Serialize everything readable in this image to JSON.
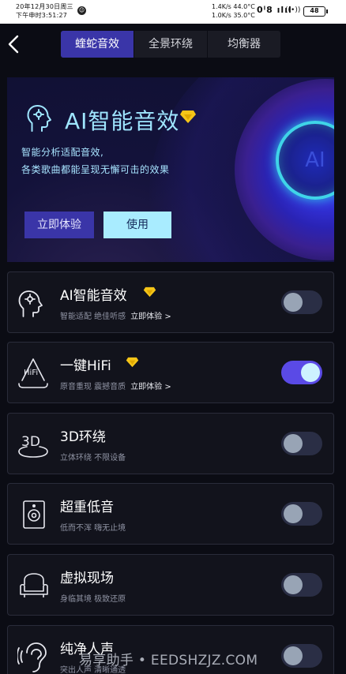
{
  "status_bar": {
    "date": "20年12月30日周三",
    "time": "下午申时3:51:27",
    "speed_up": "1.4K/s 44.0°C",
    "speed_down": "1.0K/s 35.0°C",
    "signal_icons": "0ᑊ8 ılıl",
    "wifi": "((•))",
    "battery": "48"
  },
  "tabs": [
    {
      "label": "蝰蛇音效",
      "active": true
    },
    {
      "label": "全景环绕",
      "active": false
    },
    {
      "label": "均衡器",
      "active": false
    }
  ],
  "banner": {
    "title": "AI智能音效",
    "desc_line1": "智能分析适配音效,",
    "desc_line2": "各类歌曲都能呈现无懈可击的效果",
    "try_button": "立即体验",
    "use_button": "使用",
    "ring_text": "AI"
  },
  "cards": [
    {
      "title": "AI智能音效",
      "subtitle": "智能适配 绝佳听感",
      "link": "立即体验 >",
      "vip": true,
      "enabled": false,
      "icon": "ai-head-icon"
    },
    {
      "title": "一键HiFi",
      "subtitle": "原音重现 震撼音质",
      "link": "立即体验 >",
      "vip": true,
      "enabled": true,
      "icon": "hifi-icon"
    },
    {
      "title": "3D环绕",
      "subtitle": "立体环绕 不限设备",
      "vip": false,
      "enabled": false,
      "icon": "3d-icon",
      "icon_text": "3D"
    },
    {
      "title": "超重低音",
      "subtitle": "低而不浑 嗨无止境",
      "vip": false,
      "enabled": false,
      "icon": "speaker-icon"
    },
    {
      "title": "虚拟现场",
      "subtitle": "身临其境 极致还原",
      "vip": false,
      "enabled": false,
      "icon": "armchair-icon"
    },
    {
      "title": "纯净人声",
      "subtitle": "突出人声 清晰通透",
      "vip": false,
      "enabled": false,
      "icon": "ear-icon"
    }
  ],
  "hifi_icon_text": "HiFi",
  "watermark": "易享助手 • EEDSHZJZ.COM",
  "colors": {
    "accent": "#3a35a8",
    "toggle_on": "#5a4ae6",
    "banner_text": "#9fe6ff",
    "vip_gold": "#f5c518"
  }
}
